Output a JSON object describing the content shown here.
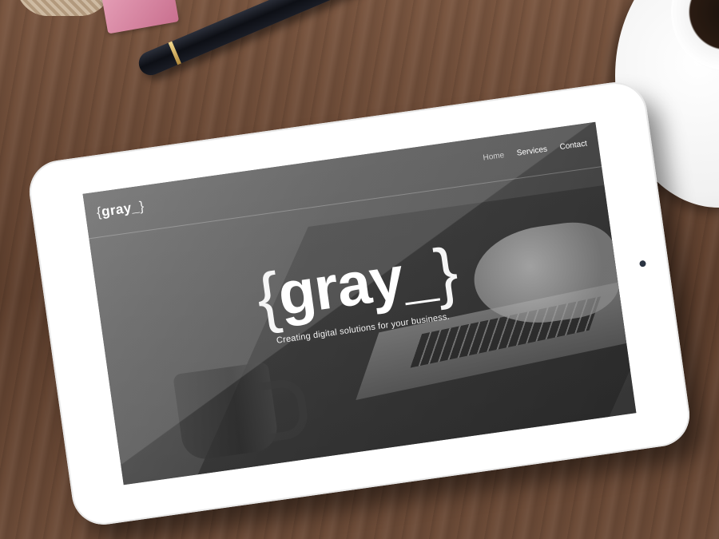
{
  "site": {
    "logo": {
      "open_brace": "{",
      "text": "gray_",
      "close_brace": "}"
    },
    "nav": {
      "items": [
        {
          "label": "Home",
          "active": true
        },
        {
          "label": "Services",
          "active": false
        },
        {
          "label": "Contact",
          "active": false
        }
      ]
    },
    "hero": {
      "logo": {
        "open_brace": "{",
        "text": "gray_",
        "close_brace": "}"
      },
      "tagline": "Creating digital solutions for your business."
    }
  },
  "colors": {
    "overlay": "#5b5b5b",
    "text": "#ffffff",
    "tablet_frame": "#ffffff"
  }
}
